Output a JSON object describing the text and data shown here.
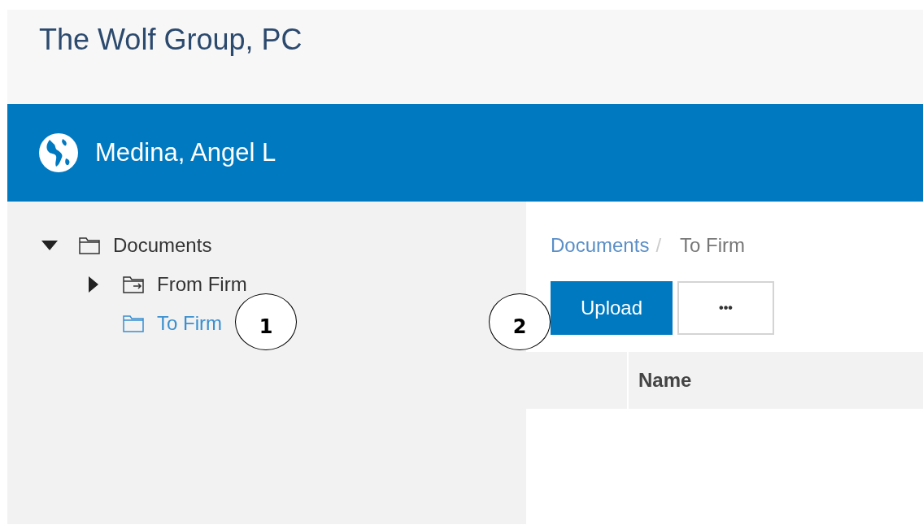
{
  "header": {
    "title": "The Wolf Group, PC"
  },
  "user_bar": {
    "name": "Medina, Angel L"
  },
  "tree": [
    {
      "label": "Documents",
      "kind": "folder",
      "expanded": true,
      "selected": false,
      "children": [
        {
          "label": "From Firm",
          "kind": "outbox",
          "expanded": false,
          "selected": false
        },
        {
          "label": "To Firm",
          "kind": "folder",
          "selected": true
        }
      ]
    }
  ],
  "breadcrumb": [
    {
      "label": "Documents",
      "current": false,
      "separator": "/"
    },
    {
      "label": "To Firm",
      "current": true
    }
  ],
  "toolbar": [
    {
      "label": "Upload",
      "kind": "primary"
    },
    {
      "label": "•••",
      "kind": "more"
    }
  ],
  "table": {
    "columns": [
      {
        "label": "Name"
      }
    ]
  },
  "callouts": [
    {
      "label": "1"
    },
    {
      "label": "2"
    }
  ]
}
